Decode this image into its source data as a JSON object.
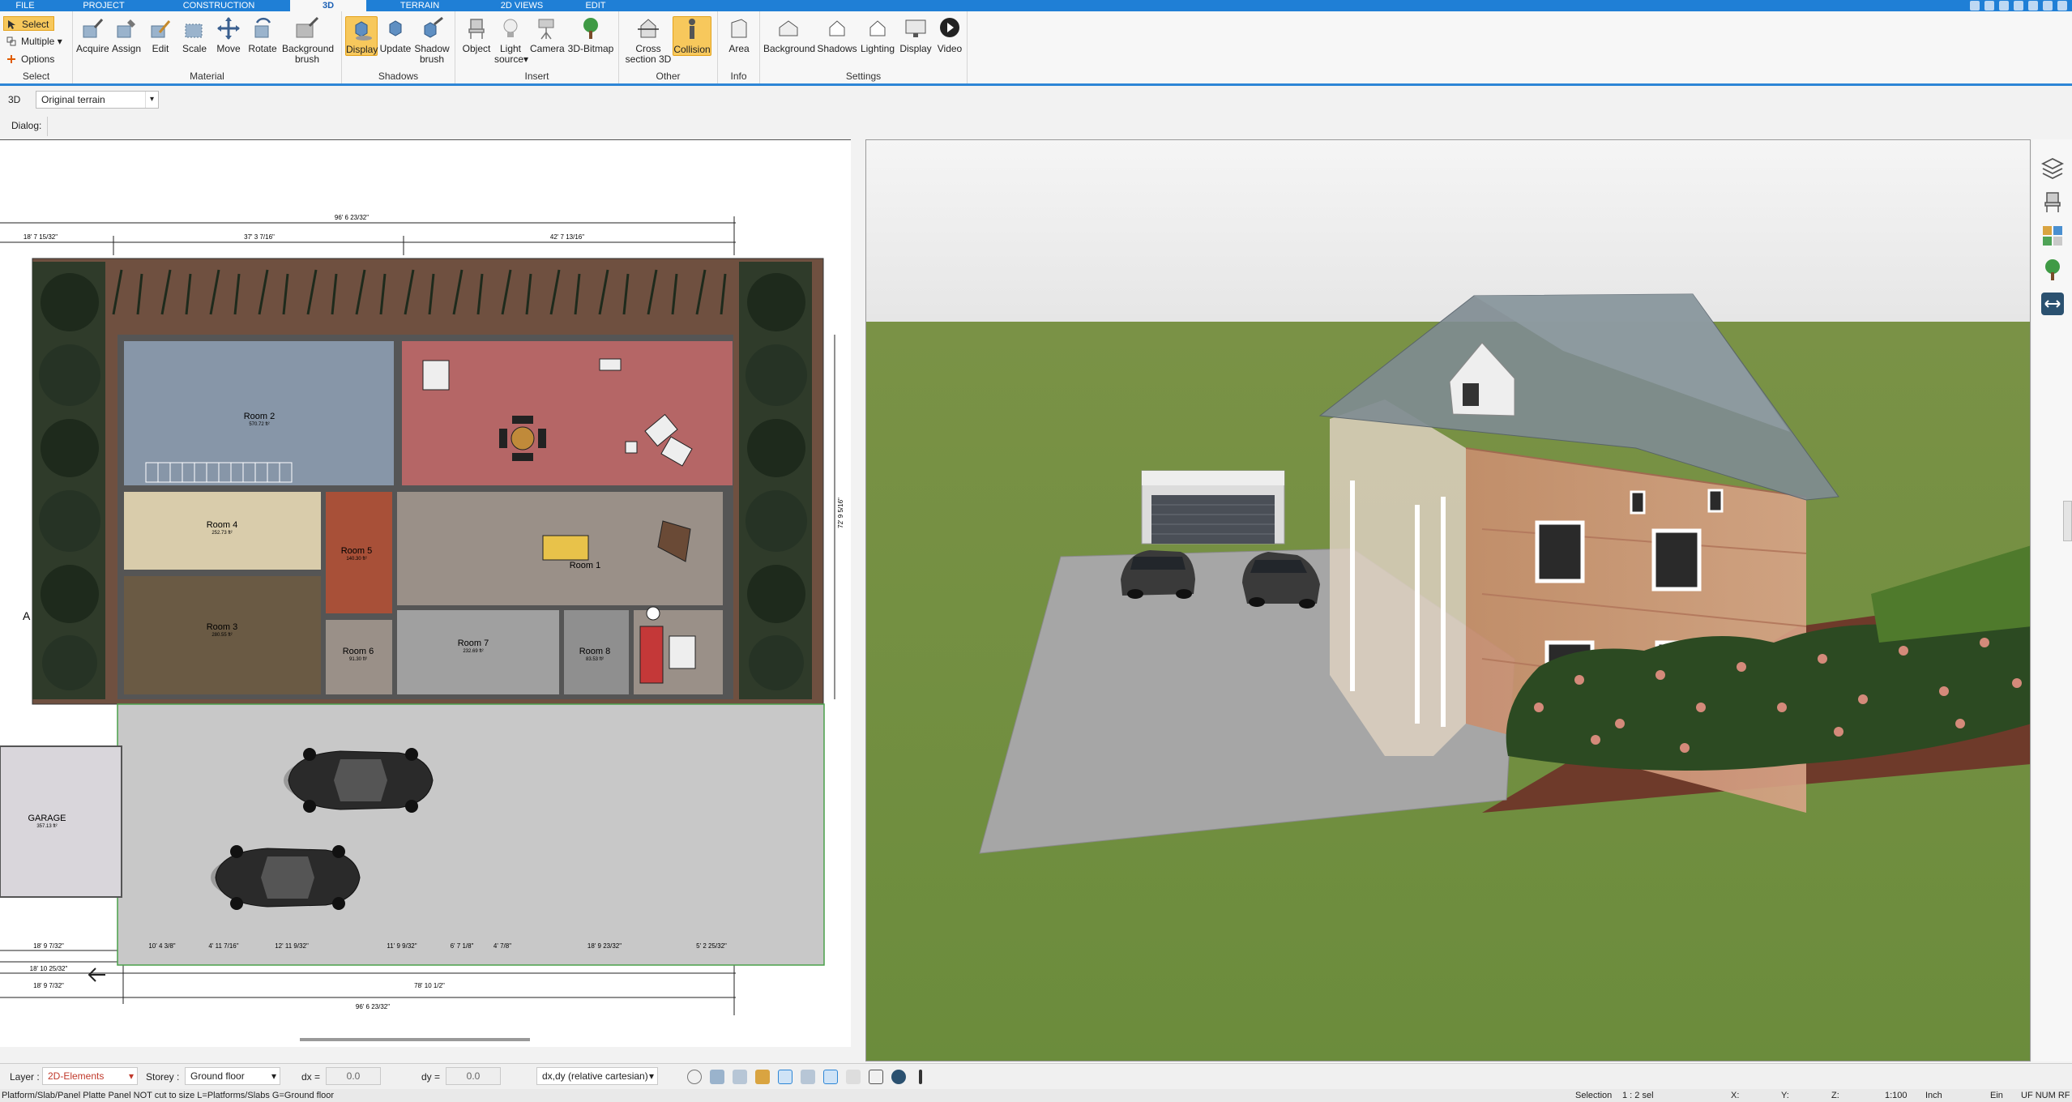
{
  "menu": {
    "tabs": [
      "FILE",
      "PROJECT",
      "CONSTRUCTION",
      "3D",
      "TERRAIN",
      "2D VIEWS",
      "EDIT"
    ],
    "active_tab": "3D"
  },
  "ribbon": {
    "select_group": {
      "label": "Select",
      "buttons": [
        "Select",
        "Multiple",
        "Options"
      ]
    },
    "material_group": {
      "label": "Material",
      "buttons": [
        "Acquire",
        "Assign",
        "Edit",
        "Scale",
        "Move",
        "Rotate",
        "Background brush"
      ]
    },
    "shadows_group": {
      "label": "Shadows",
      "buttons": [
        "Display",
        "Update",
        "Shadow brush"
      ]
    },
    "insert_group": {
      "label": "Insert",
      "buttons": [
        "Object",
        "Light source",
        "Camera",
        "3D-Bitmap"
      ]
    },
    "other_group": {
      "label": "Other",
      "buttons": [
        "Cross section 3D",
        "Collision"
      ]
    },
    "info_group": {
      "label": "Info",
      "buttons": [
        "Area"
      ]
    },
    "settings_group": {
      "label": "Settings",
      "buttons": [
        "Background",
        "Shadows",
        "Lighting",
        "Display",
        "Video"
      ]
    },
    "colors": {
      "accent": "#1f7fd6",
      "active": "#f7c85c"
    }
  },
  "toolrow": {
    "view_tag": "3D",
    "terrain_select": "Original terrain",
    "dialog_label": "Dialog:"
  },
  "plan": {
    "rooms": [
      {
        "name": "Room 2",
        "area": "570.72 ft²"
      },
      {
        "name": "Room 4",
        "area": "252.73 ft²"
      },
      {
        "name": "Room 3",
        "area": "280.55 ft²"
      },
      {
        "name": "Room 5",
        "area": "140.30 ft²"
      },
      {
        "name": "Room 6",
        "area": "91.30 ft²"
      },
      {
        "name": "Room 7",
        "area": "232.69 ft²"
      },
      {
        "name": "Room 8",
        "area": "83.53 ft²"
      },
      {
        "name": "Room 1",
        "area": ""
      },
      {
        "name": "GARAGE",
        "area": "357.13 ft²"
      }
    ],
    "dimensions": {
      "top_total": "96' 6 23/32\"",
      "top_left": "18' 7 15/32\"",
      "top_mid": "37' 3 7/16\"",
      "top_right": "42' 7 13/16\"",
      "bottom_total": "96' 6 23/32\"",
      "bottom_a": "18' 9 7/32\"",
      "bottom_b": "18' 10 25/32\"",
      "bottom_c": "18' 9 7/32\"",
      "bottom_d": "78' 10 1/2\"",
      "right_a": "72' 9 5/16\"",
      "bottom_segments": [
        "10' 4 3/8\"",
        "4' 11 7/16\"",
        "12' 11 9/32\"",
        "11' 9 9/32\"",
        "6' 7 1/8\"",
        "4' 7/8\"",
        "18' 9 23/32\"",
        "5' 2 25/32\""
      ]
    },
    "marker_letter": "A"
  },
  "bottombar": {
    "layer_label": "Layer :",
    "layer_value": "2D-Elements",
    "storey_label": "Storey :",
    "storey_value": "Ground floor",
    "dx_label": "dx =",
    "dx_value": "0.0",
    "dy_label": "dy =",
    "dy_value": "0.0",
    "coord_mode": "dx,dy (relative cartesian)"
  },
  "statusbar": {
    "hint": "Platform/Slab/Panel Platte Panel NOT cut to size L=Platforms/Slabs G=Ground floor",
    "selection_label": "Selection",
    "selection_value": "1 : 2 sel",
    "x_label": "X:",
    "y_label": "Y:",
    "z_label": "Z:",
    "scale": "1:100",
    "unit": "Inch",
    "ein": "Ein",
    "flags": "UF NUM RF"
  }
}
